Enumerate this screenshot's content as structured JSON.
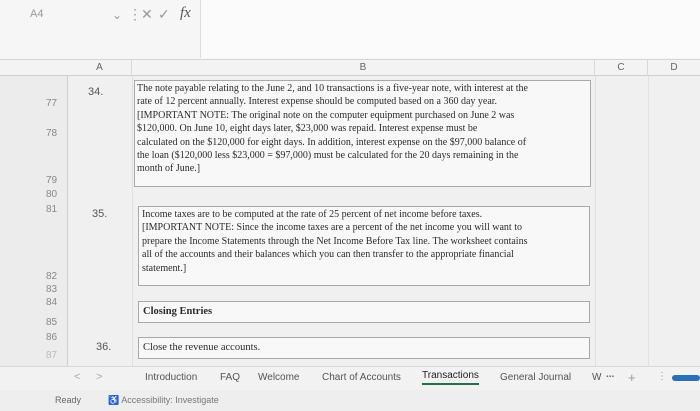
{
  "formula_bar": {
    "cell_ref": "A4",
    "chevron": "⌄",
    "more": "⋮",
    "cancel": "✕",
    "confirm": "✓",
    "fx": "fx"
  },
  "columns": [
    "A",
    "B",
    "C",
    "D"
  ],
  "rows": [
    "77",
    "78",
    "79",
    "80",
    "81",
    "82",
    "83",
    "84",
    "85",
    "86",
    "87"
  ],
  "cells": {
    "num34": "34.",
    "num35": "35.",
    "num36": "36.",
    "note34_lines": [
      "The note payable relating to the June 2, and 10 transactions is a five-year note, with interest at the",
      "rate of 12 percent annually. Interest expense should be computed based on a 360 day year.",
      "[IMPORTANT NOTE: The original note on the computer equipment purchased on June 2 was",
      "$120,000. On June 10, eight days later, $23,000 was repaid. Interest expense must be",
      "calculated on the $120,000 for eight days. In addition, interest expense on the $97,000 balance of",
      "the loan ($120,000 less $23,000 = $97,000) must be calculated for the 20 days remaining in the",
      "month of June.]"
    ],
    "note35_lines": [
      "Income taxes are to be computed at the rate of 25 percent of net income before taxes.",
      "[IMPORTANT NOTE: Since the income taxes are a percent of the net income you will want to",
      "prepare the Income Statements through the Net Income Before Tax line. The worksheet contains",
      "all of the accounts and their balances which you can then transfer to the appropriate financial",
      "statement.]"
    ],
    "closing_entries": "Closing Entries",
    "close_revenue": "Close the revenue accounts."
  },
  "tabs": {
    "nav_prev": "<",
    "nav_next": ">",
    "items": [
      "Introduction",
      "FAQ",
      "Welcome",
      "Chart of Accounts",
      "Transactions",
      "General Journal",
      "W"
    ],
    "active": "Transactions",
    "more": "...",
    "add": "+",
    "options": "⋮"
  },
  "status": {
    "ready": "Ready",
    "accessibility": "Accessibility: Investigate"
  },
  "colors": {
    "active_tab_underline": "#217346",
    "scroll_thumb": "#2b6fb6"
  }
}
